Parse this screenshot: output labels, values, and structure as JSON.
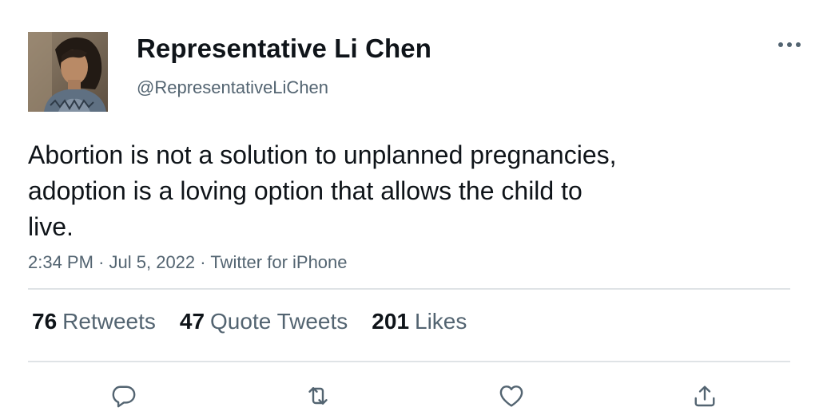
{
  "author": {
    "display_name": "Representative Li Chen",
    "handle": "@RepresentativeLiChen"
  },
  "tweet": {
    "text": "Abortion is not a solution to unplanned pregnancies,\nadoption is a loving option that allows the child to\nlive.",
    "time": "2:34 PM",
    "date": "Jul 5, 2022",
    "source": "Twitter for iPhone",
    "separator": "·"
  },
  "stats": {
    "retweets": {
      "count": "76",
      "label": "Retweets"
    },
    "quotes": {
      "count": "47",
      "label": "Quote Tweets"
    },
    "likes": {
      "count": "201",
      "label": "Likes"
    }
  },
  "icons": {
    "more": "more-horizontal-icon",
    "reply": "reply-icon",
    "retweet": "retweet-icon",
    "like": "heart-icon",
    "share": "share-icon"
  },
  "colors": {
    "text": "#0f1419",
    "secondary": "#536471",
    "divider": "#dfe3e6"
  }
}
